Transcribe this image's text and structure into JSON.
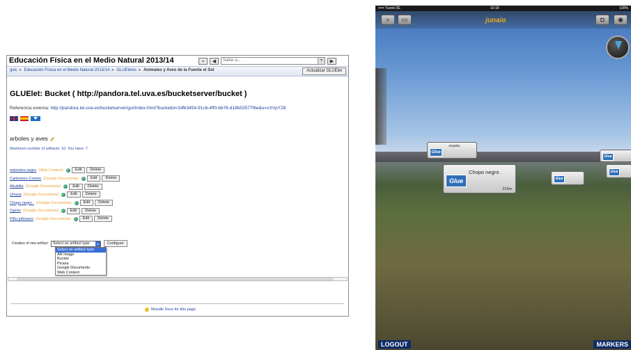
{
  "moodle": {
    "course_title": "Educación Física en el Medio Natural 2013/14",
    "jump_placeholder": "Saltar a...",
    "breadcrumb": [
      "gsic",
      "Educación Física en el Medio Natural 2013/14",
      "GLUEletss",
      "Animales y Aves de la Fuente el Sol"
    ],
    "update_button": "Actualizar GLUElet",
    "gluelet_title": "GLUElet: Bucket ( http://pandora.tel.uva.es/bucketserver/bucket )",
    "external_ref_label": "Referencia externa:",
    "external_ref_url": "http://pandora.tel.uva.es/bucketserver/gui/index.html?bucketid=2dfb3454-91c6-4ff0-bb76-d18b53577f6e&u=cXVpY28",
    "bucket_name": "arboles y aves",
    "max_artifacts": "Maximum number of artifacts: 10. You have: 7",
    "artifacts": [
      {
        "name": "estornino negro",
        "type": "(Web Content)"
      },
      {
        "name": "Carbonero Común",
        "type": "(Google Documents)"
      },
      {
        "name": "Abubilla",
        "type": "(Google Documents)"
      },
      {
        "name": "Urraca",
        "type": "(Google Documents)"
      },
      {
        "name": "Chopo negro .",
        "type": "(Google Documents)"
      },
      {
        "name": "Ciprés",
        "type": "(Google Documents)"
      },
      {
        "name": "Piño piñonero",
        "type": "(Google Documents)"
      }
    ],
    "edit_label": "Edit",
    "delete_label": "Delete",
    "creation_label": "Creation of new artifact:",
    "artifact_select_value": "Select an artifact type",
    "configure_label": "Configure",
    "artifact_options": [
      "Select an artifact type",
      "AR Image",
      "Bucket",
      "Picasa",
      "Google Documents",
      "Web Content"
    ],
    "footer_link": "Moodle Docs for this page"
  },
  "phone": {
    "carrier": "••••• Tuenti 3G",
    "time": "10:18",
    "battery": "100%",
    "app_logo": "junaio",
    "search_icon": "search-icon",
    "poi_main_name": "Chopo negro .",
    "poi_main_distance": "215m",
    "poi_small_name": "Abubilla",
    "poi_icon_label": "Glue",
    "logout_label": "LOGOUT",
    "markers_label": "MARKERS"
  },
  "colors": {
    "link": "#1b3f9b",
    "artifact_type": "#e8a030",
    "selected_option": "#3a6ed5",
    "bottom_bar": "#0d2b66",
    "logo": "#f0a91e"
  }
}
